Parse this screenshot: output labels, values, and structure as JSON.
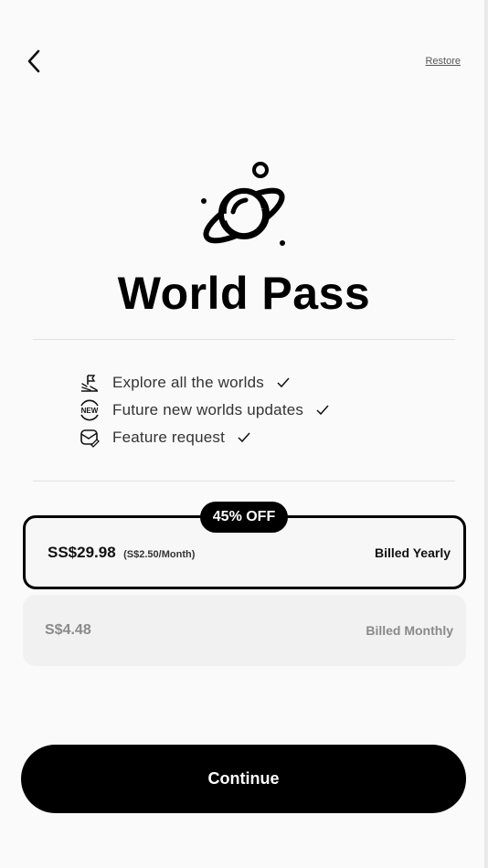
{
  "header": {
    "back_icon": "chevron-left-icon",
    "restore_label": "Restore"
  },
  "hero": {
    "logo_icon": "planet-icon",
    "title": "World Pass"
  },
  "features": [
    {
      "icon": "map-flag-icon",
      "label": "Explore all the worlds",
      "check": "check-icon"
    },
    {
      "icon": "new-badge-icon",
      "label": "Future new worlds updates",
      "check": "check-icon"
    },
    {
      "icon": "request-edit-icon",
      "label": "Feature request",
      "check": "check-icon"
    }
  ],
  "plans": {
    "yearly": {
      "badge": "45% OFF",
      "price": "SS$29.98",
      "per_month": "(S$2.50/Month)",
      "billing": "Billed Yearly",
      "selected": true
    },
    "monthly": {
      "price": "S$4.48",
      "billing": "Billed Monthly",
      "selected": false
    }
  },
  "cta": {
    "label": "Continue"
  },
  "colors": {
    "background": "#fafafa",
    "primary": "#000000",
    "muted_text": "#8a8a8a",
    "card_unselected": "#f1f1f1"
  }
}
